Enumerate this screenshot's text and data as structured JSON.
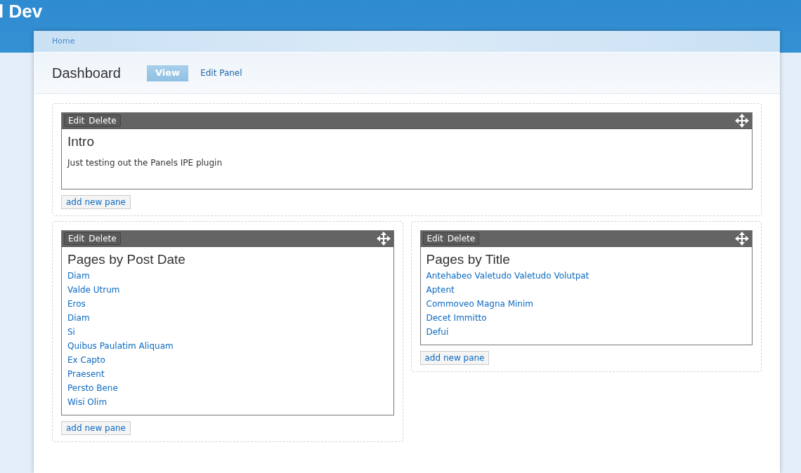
{
  "site_title": "l Dev",
  "breadcrumb": [
    "Home"
  ],
  "page_title": "Dashboard",
  "tabs": [
    {
      "label": "View",
      "selected": true
    },
    {
      "label": "Edit Panel",
      "selected": false
    }
  ],
  "top_region": {
    "panes": [
      {
        "kind": "text",
        "actions": [
          "Edit",
          "Delete"
        ],
        "title": "Intro",
        "body": "Just testing out the Panels IPE plugin"
      }
    ],
    "add_button": "add new pane"
  },
  "columns": [
    {
      "panes": [
        {
          "kind": "links",
          "actions": [
            "Edit",
            "Delete"
          ],
          "title": "Pages by Post Date",
          "links": [
            "Diam",
            "Valde Utrum",
            "Eros",
            "Diam",
            "Si",
            "Quibus Paulatim Aliquam",
            "Ex Capto",
            "Praesent",
            "Persto Bene",
            "Wisi Olim"
          ]
        }
      ],
      "add_button": "add new pane"
    },
    {
      "panes": [
        {
          "kind": "links",
          "actions": [
            "Edit",
            "Delete"
          ],
          "title": "Pages by Title",
          "links": [
            "Antehabeo Valetudo Valetudo Volutpat",
            "Aptent",
            "Commoveo Magna Minim",
            "Decet Immitto",
            "Defui"
          ]
        }
      ],
      "add_button": "add new pane"
    }
  ]
}
